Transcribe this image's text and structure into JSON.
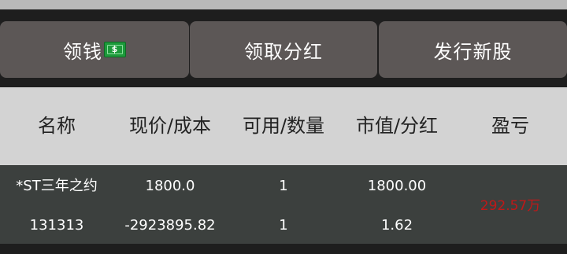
{
  "buttons": {
    "get_money_label": "领钱",
    "get_money_icon": "dollar-banknote-icon",
    "dividend_label": "领取分红",
    "issue_label": "发行新股"
  },
  "table": {
    "headers": [
      "名称",
      "现价/成本",
      "可用/数量",
      "市值/分红",
      "盈亏"
    ],
    "holding": {
      "name": "*ST三年之约",
      "code": "131313",
      "price": "1800.0",
      "cost": "-2923895.82",
      "available": "1",
      "quantity": "1",
      "market_value": "1800.00",
      "dividend": "1.62",
      "profit_loss": "292.57万"
    }
  },
  "colors": {
    "button_bg": "#5c5756",
    "header_bg": "#d3d3d3",
    "row_bg": "#3c403e",
    "profit_color": "#c01818",
    "money_icon": "#1d9a3b"
  }
}
